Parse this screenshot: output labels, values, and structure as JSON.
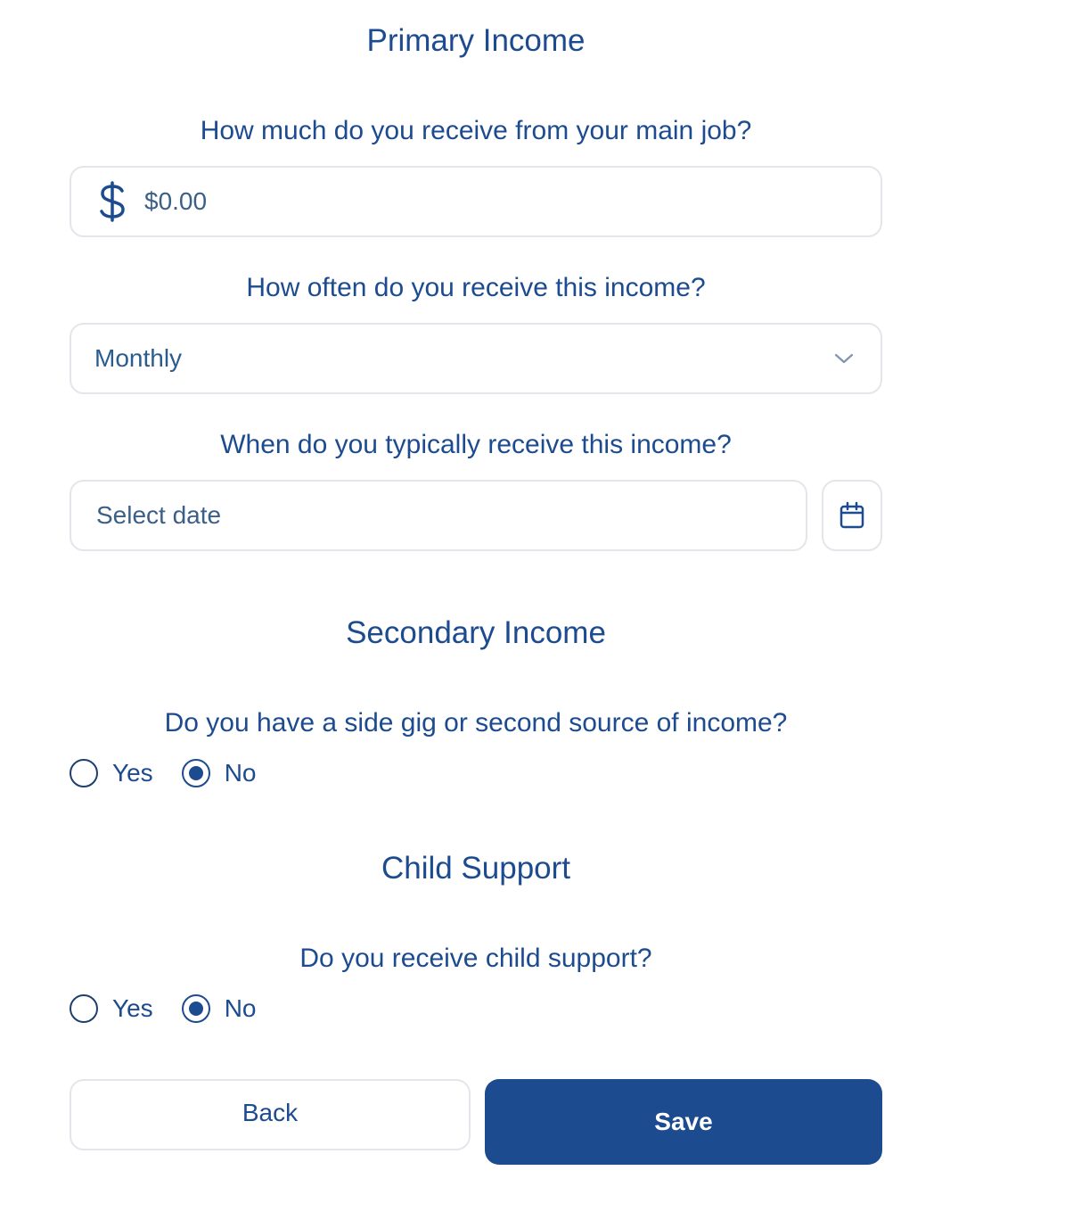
{
  "primary": {
    "title": "Primary Income",
    "amount_question": "How much do you receive from your main job?",
    "amount_placeholder": "$0.00",
    "frequency_question": "How often do you receive this income?",
    "frequency_value": "Monthly",
    "date_question": "When do you typically receive this income?",
    "date_placeholder": "Select date"
  },
  "secondary": {
    "title": "Secondary Income",
    "question": "Do you have a side gig or second source of income?",
    "options": [
      {
        "label": "Yes",
        "checked": false
      },
      {
        "label": "No",
        "checked": true
      }
    ]
  },
  "child_support": {
    "title": "Child Support",
    "question": "Do you receive child support?",
    "options": [
      {
        "label": "Yes",
        "checked": false
      },
      {
        "label": "No",
        "checked": true
      }
    ]
  },
  "actions": {
    "back_label": "Back",
    "save_label": "Save"
  },
  "colors": {
    "primary": "#1d4b8f",
    "border": "#e3e6ea"
  },
  "icons": {
    "amount": "dollar-icon",
    "frequency": "chevron-down-icon",
    "date": "calendar-icon"
  }
}
